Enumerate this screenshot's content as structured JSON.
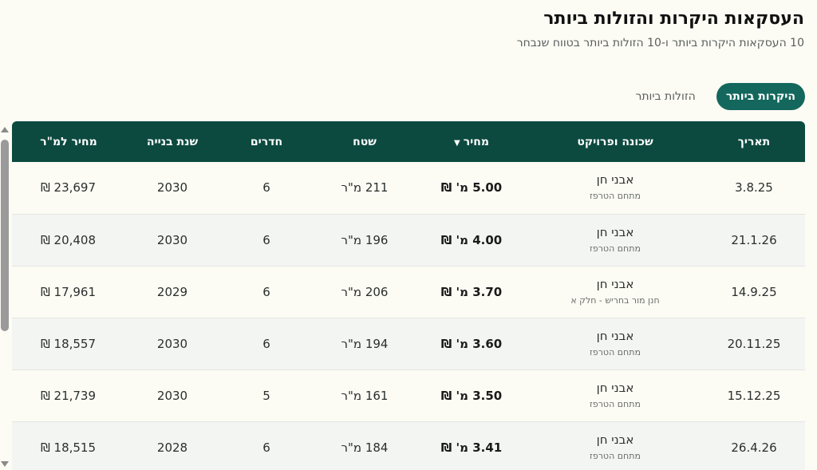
{
  "header": {
    "title": "העסקאות היקרות והזולות ביותר",
    "subtitle": "10 העסקאות היקרות ביותר ו-10 הזולות ביותר בטווח שנבחר"
  },
  "tabs": [
    {
      "label": "היקרות ביותר",
      "active": true
    },
    {
      "label": "הזולות ביותר",
      "active": false
    }
  ],
  "table": {
    "columns": [
      {
        "label": "תאריך"
      },
      {
        "label": "שכונה ופרויקט"
      },
      {
        "label": "מחיר",
        "sort_indicator": "▼"
      },
      {
        "label": "שטח"
      },
      {
        "label": "חדרים"
      },
      {
        "label": "שנת בנייה"
      },
      {
        "label": "מחיר למ\"ר"
      }
    ],
    "rows": [
      {
        "date": "3.8.25",
        "project": "אבני חן",
        "sub": "מתחם הטרפז",
        "price": "5.00 מ' ₪",
        "area": "211 מ\"ר",
        "rooms": "6",
        "year": "2030",
        "ppm": "23,697 ₪"
      },
      {
        "date": "21.1.26",
        "project": "אבני חן",
        "sub": "מתחם הטרפז",
        "price": "4.00 מ' ₪",
        "area": "196 מ\"ר",
        "rooms": "6",
        "year": "2030",
        "ppm": "20,408 ₪"
      },
      {
        "date": "14.9.25",
        "project": "אבני חן",
        "sub": "חנן מור בחריש - חלק א",
        "price": "3.70 מ' ₪",
        "area": "206 מ\"ר",
        "rooms": "6",
        "year": "2029",
        "ppm": "17,961 ₪"
      },
      {
        "date": "20.11.25",
        "project": "אבני חן",
        "sub": "מתחם הטרפז",
        "price": "3.60 מ' ₪",
        "area": "194 מ\"ר",
        "rooms": "6",
        "year": "2030",
        "ppm": "18,557 ₪"
      },
      {
        "date": "15.12.25",
        "project": "אבני חן",
        "sub": "מתחם הטרפז",
        "price": "3.50 מ' ₪",
        "area": "161 מ\"ר",
        "rooms": "5",
        "year": "2030",
        "ppm": "21,739 ₪"
      },
      {
        "date": "26.4.26",
        "project": "אבני חן",
        "sub": "מתחם הטרפז",
        "price": "3.41 מ' ₪",
        "area": "184 מ\"ר",
        "rooms": "6",
        "year": "2028",
        "ppm": "18,515 ₪"
      }
    ]
  },
  "colors": {
    "accent": "#14675c",
    "header_bg": "#0c4a40",
    "page_bg": "#fcfbf4"
  }
}
